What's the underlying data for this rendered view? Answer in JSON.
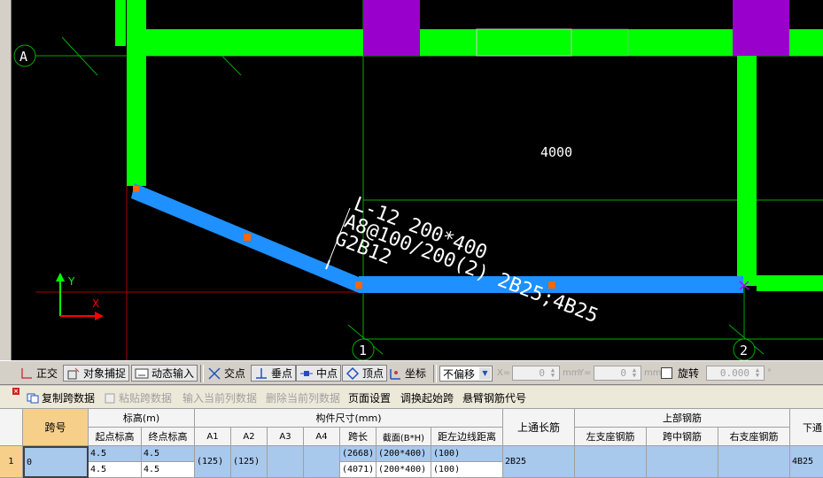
{
  "cad": {
    "axis_a_label": "A",
    "axis_1_label": "1",
    "axis_2_label": "2",
    "span_dim": "4000",
    "beam_annotation": {
      "line1": "L-12 200*400",
      "line2": "A8@100/200(2) 2B25;4B25",
      "line3": "G2B12"
    },
    "ucs_x": "X",
    "ucs_y": "Y",
    "colors": {
      "background": "#000000",
      "wall": "#00ff00",
      "column": "#9900cc",
      "beam": "#1e90ff",
      "grip": "#ff6600",
      "axis": "#00aa00",
      "red_axis": "#cc0000"
    }
  },
  "snapbar": {
    "ortho": "正交",
    "snap": "对象捕捉",
    "dyn_input": "动态输入",
    "intersection": "交点",
    "perpendicular": "垂点",
    "midpoint": "中点",
    "vertex": "顶点",
    "coord": "坐标",
    "offset_select": "不偏移",
    "x_label": "X=",
    "x_value": "0",
    "x_unit": "mm",
    "y_label": "Y=",
    "y_value": "0",
    "y_unit": "mm",
    "rotate_label": "旋转",
    "rotate_value": "0.000",
    "deg": "°"
  },
  "menubar": {
    "copy_span": "复制跨数据",
    "paste_span": "粘贴跨数据",
    "input_col": "输入当前列数据",
    "delete_col": "删除当前列数据",
    "page_setup": "页面设置",
    "swap_start": "调换起始跨",
    "cantilever": "悬臂钢筋代号"
  },
  "grid": {
    "h_span": "跨号",
    "h_elev": "标高(m)",
    "h_elev_start": "起点标高",
    "h_elev_end": "终点标高",
    "h_size": "构件尺寸(mm)",
    "h_a1": "A1",
    "h_a2": "A2",
    "h_a3": "A3",
    "h_a4": "A4",
    "h_len": "跨长",
    "h_sect": "截面(B*H)",
    "h_edge": "距左边线距离",
    "h_top_through": "上通长筋",
    "h_top": "上部钢筋",
    "h_left_sup": "左支座钢筋",
    "h_mid": "跨中钢筋",
    "h_right_sup": "右支座钢筋",
    "h_bottom": "下通",
    "row_num": "1",
    "row_span_val": "0",
    "r1": {
      "start": "4.5",
      "end": "4.5",
      "len": "(2668)",
      "sect": "(200*400)",
      "edge": "(100)"
    },
    "r2": {
      "start": "4.5",
      "end": "4.5",
      "len": "(4071)",
      "sect": "(200*400)",
      "edge": "(100)"
    },
    "a1": "(125)",
    "a2": "(125)",
    "top_through": "2B25",
    "bottom": "4B25"
  }
}
